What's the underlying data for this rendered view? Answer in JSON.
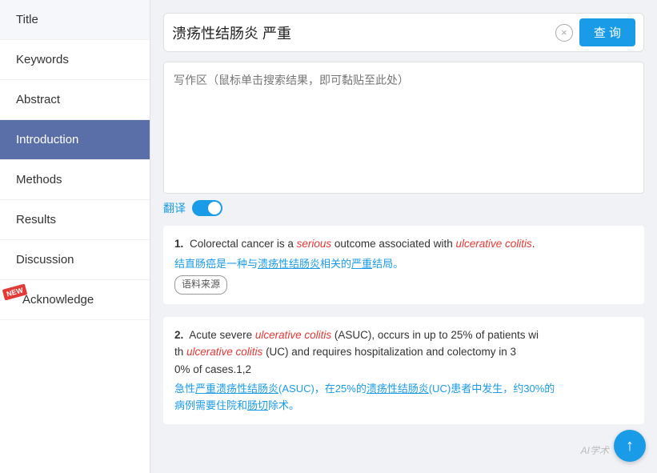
{
  "sidebar": {
    "items": [
      {
        "id": "title",
        "label": "Title",
        "active": false
      },
      {
        "id": "keywords",
        "label": "Keywords",
        "active": false
      },
      {
        "id": "abstract",
        "label": "Abstract",
        "active": false
      },
      {
        "id": "introduction",
        "label": "Introduction",
        "active": true
      },
      {
        "id": "methods",
        "label": "Methods",
        "active": false
      },
      {
        "id": "results",
        "label": "Results",
        "active": false
      },
      {
        "id": "discussion",
        "label": "Discussion",
        "active": false
      },
      {
        "id": "acknowledge",
        "label": "Acknowledge",
        "active": false,
        "badge": "NEW"
      }
    ]
  },
  "searchbar": {
    "query": "溃疡性结肠炎 严重",
    "clear_label": "×",
    "search_label": "查 询"
  },
  "writearea": {
    "placeholder": "写作区（鼠标单击搜索结果，即可黏贴至此处）"
  },
  "toggle": {
    "label": "翻译"
  },
  "results": [
    {
      "number": "1.",
      "text_parts": [
        {
          "type": "normal",
          "text": "Colorectal cancer is a "
        },
        {
          "type": "italic-red",
          "text": "serious"
        },
        {
          "type": "normal",
          "text": " outcome associated with "
        },
        {
          "type": "italic-red",
          "text": "ulcerative colitis"
        },
        {
          "type": "normal",
          "text": "."
        }
      ],
      "translation": "结直肠癌是一种与溃疡性结肠炎相关的严重结局。",
      "source": "语料来源",
      "has_source_badge": true
    },
    {
      "number": "2.",
      "text_parts": [
        {
          "type": "normal",
          "text": "Acute severe "
        },
        {
          "type": "italic-red",
          "text": "ulcerative colitis"
        },
        {
          "type": "normal",
          "text": " (ASUC), occurs in up to 25% of patients with "
        },
        {
          "type": "italic-red",
          "text": "ulcerative colitis"
        },
        {
          "type": "normal",
          "text": " (UC) and requires hospitalization and colectomy in 30% of cases.1,2"
        }
      ],
      "translation": "急性严重溃疡性结肠炎(ASUC)，在25%的溃疡性结肠炎(UC)患者中发生，约30%的病例需要住院和肠切除术。",
      "has_source_badge": false
    }
  ],
  "watermark": "AI学术",
  "scroll_up": "↑"
}
